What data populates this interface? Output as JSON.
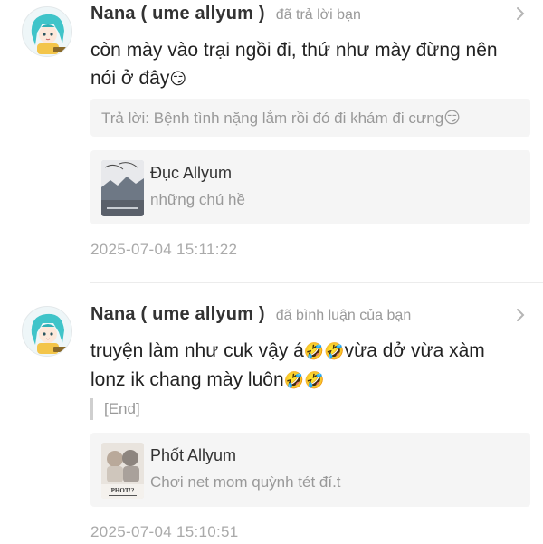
{
  "notifications": [
    {
      "user_name": "Nana ( ume allyum )",
      "action": "đã trả lời bạn",
      "text_line1": "còn mày vào trại ngồi đi, thứ như mày đừng nên",
      "text_line2": "nói ở đây",
      "text_line2_emoji": "😏",
      "reply_quote": "Trả lời: Bệnh tình nặng lắm rồi đó đi khám đi cưng",
      "reply_quote_emoji": "😏",
      "post_title": "Đục Allyum",
      "post_subtitle": "những chú hề",
      "timestamp": "2025-07-04 15:11:22"
    },
    {
      "user_name": "Nana ( ume allyum )",
      "action": "đã bình luận của bạn",
      "text_line1_a": "truyện làm như cuk vậy á",
      "text_line1_emoji": "🤣🤣",
      "text_line1_b": "vừa dở vừa xàm",
      "text_line2": "lonz ik chang mày luôn",
      "text_line2_emoji": "🤣🤣",
      "quote": "[End]",
      "post_title": "Phốt Allyum",
      "post_subtitle": "Chơi net mom quỳnh tét đí.t",
      "post_thumb_text": "PHOT!?",
      "timestamp": "2025-07-04 15:10:51"
    }
  ],
  "icons": {
    "chevron": "chevron-right-icon",
    "avatar": "avatar-icon"
  },
  "colors": {
    "name": "#333333",
    "muted": "#999999",
    "card_bg": "#f5f5f5",
    "avatar_hair": "#3fc4c9"
  }
}
